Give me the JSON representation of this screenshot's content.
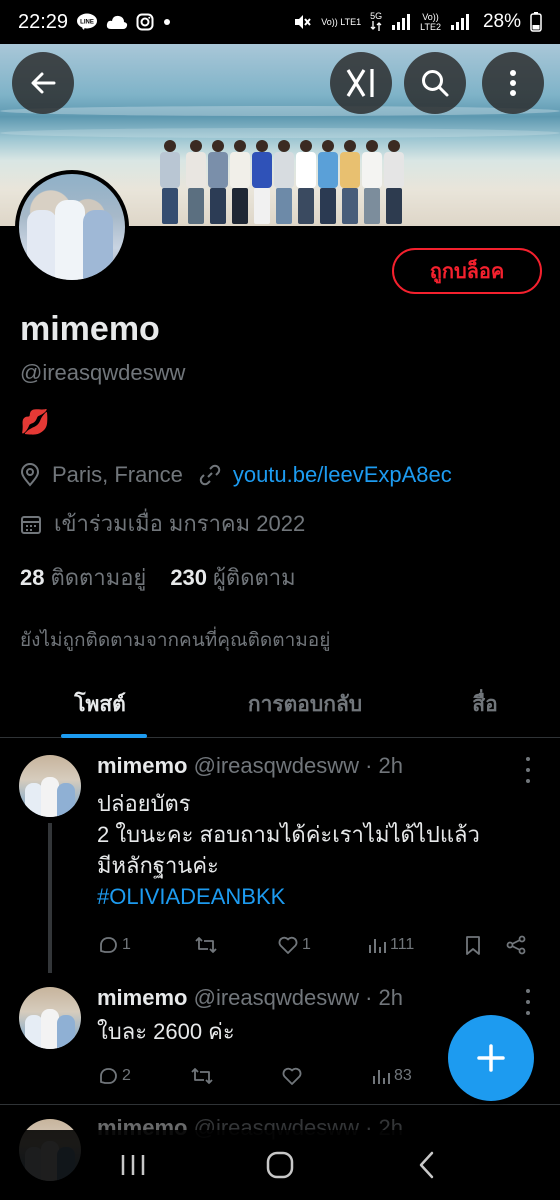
{
  "status_bar": {
    "time": "22:29",
    "line_icon": "LINE",
    "lte1": "Vo)) LTE1",
    "lte1_label": "LTE1",
    "net_label": "5G",
    "lte2_label": "LTE2",
    "battery": "28%"
  },
  "header": {
    "back_icon": "arrow-left-icon",
    "grok_icon": "grok-icon",
    "search_icon": "search-icon",
    "more_icon": "more-vertical-icon"
  },
  "profile": {
    "blocked_label": "ถูกบล็อค",
    "name": "mimemo",
    "handle": "@ireasqwdesww",
    "bio": "💋",
    "location": "Paris, France",
    "link": "youtu.be/leevExpA8ec",
    "joined": "เข้าร่วมเมื่อ มกราคม 2022",
    "following_count": "28",
    "following_label": "ติดตามอยู่",
    "followers_count": "230",
    "followers_label": "ผู้ติดตาม",
    "not_followed_text": "ยังไม่ถูกติดตามจากคนที่คุณติดตามอยู่"
  },
  "tabs": [
    {
      "label": "โพสต์",
      "active": true
    },
    {
      "label": "การตอบกลับ",
      "active": false
    },
    {
      "label": "สื่อ",
      "active": false
    }
  ],
  "tweets": [
    {
      "name": "mimemo",
      "meta": "@ireasqwdesww · 2h",
      "lines": [
        "ปล่อยบัตร",
        "2 ใบนะคะ สอบถามได้ค่ะเราไม่ได้ไปแล้ว",
        "มีหลักฐานค่ะ"
      ],
      "hashtag": "#OLIVIADEANBKK",
      "replies": "1",
      "retweets": "",
      "likes": "1",
      "views": "111"
    },
    {
      "name": "mimemo",
      "meta": "@ireasqwdesww · 2h",
      "lines": [
        "ใบละ 2600 ค่ะ"
      ],
      "replies": "2",
      "retweets": "",
      "likes": "",
      "views": "83"
    },
    {
      "name": "mimemo",
      "meta": "@ireasqwdesww · 2h"
    }
  ],
  "colors": {
    "accent": "#1d9bf0",
    "blocked": "#f4212e",
    "muted": "#71767b",
    "background": "#000000"
  },
  "nav": {
    "recents_icon": "recents-icon",
    "home_icon": "home-icon",
    "back_icon": "back-chevron-icon"
  }
}
